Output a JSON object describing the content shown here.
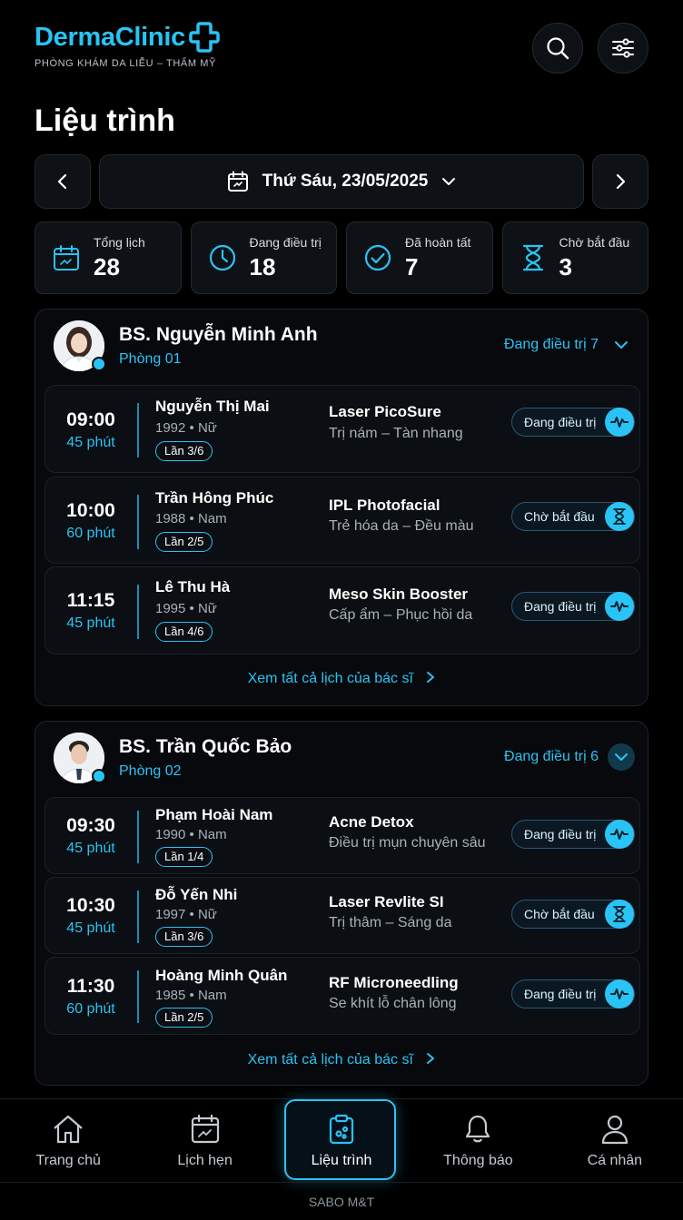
{
  "brand": {
    "name": "DermaClinic",
    "tagline": "PHÒNG KHÁM DA LIỄU – THẨM MỸ"
  },
  "page_title": "Liệu trình",
  "date_label": "Thứ Sáu, 23/05/2025",
  "stats": [
    {
      "label": "Tổng lịch",
      "value": "28",
      "icon": "calendar-icon"
    },
    {
      "label": "Đang điều trị",
      "value": "18",
      "icon": "clock-icon"
    },
    {
      "label": "Đã hoàn tất",
      "value": "7",
      "icon": "check-circle-icon"
    },
    {
      "label": "Chờ bắt đầu",
      "value": "3",
      "icon": "hourglass-icon"
    }
  ],
  "doctors": [
    {
      "name": "BS. Nguyễn Minh Anh",
      "room": "Phòng 01",
      "status": "Đang điều trị 7",
      "view_all": "Xem tất cả lịch của bác sĩ",
      "appointments": [
        {
          "time": "09:00",
          "duration": "45 phút",
          "patient": "Nguyễn Thị Mai",
          "info": "1992 • Nữ",
          "session": "Lần 3/6",
          "service": "Laser PicoSure",
          "desc": "Trị nám – Tàn nhang",
          "status": "Đang điều trị"
        },
        {
          "time": "10:00",
          "duration": "60 phút",
          "patient": "Trần Hông Phúc",
          "info": "1988 • Nam",
          "session": "Lần 2/5",
          "service": "IPL Photofacial",
          "desc": "Trẻ hóa da – Đều màu",
          "status": "Chờ bắt đầu"
        },
        {
          "time": "11:15",
          "duration": "45 phút",
          "patient": "Lê Thu Hà",
          "info": "1995 • Nữ",
          "session": "Lần 4/6",
          "service": "Meso Skin Booster",
          "desc": "Cấp ẩm – Phục hồi da",
          "status": "Đang điều trị"
        }
      ]
    },
    {
      "name": "BS. Trần Quốc Bảo",
      "room": "Phòng 02",
      "status": "Đang điều trị 6",
      "view_all": "Xem tất cả lịch của bác sĩ",
      "appointments": [
        {
          "time": "09:30",
          "duration": "45 phút",
          "patient": "Phạm Hoài Nam",
          "info": "1990 • Nam",
          "session": "Lần 1/4",
          "service": "Acne Detox",
          "desc": "Điều trị mụn chuyên sâu",
          "status": "Đang điều trị"
        },
        {
          "time": "10:30",
          "duration": "45 phút",
          "patient": "Đỗ Yến Nhi",
          "info": "1997 • Nữ",
          "session": "Lần 3/6",
          "service": "Laser Revlite SI",
          "desc": "Trị thâm – Sáng da",
          "status": "Chờ bắt đầu"
        },
        {
          "time": "11:30",
          "duration": "60 phút",
          "patient": "Hoàng Minh Quân",
          "info": "1985 • Nam",
          "session": "Lần 2/5",
          "service": "RF Microneedling",
          "desc": "Se khít lỗ chân lông",
          "status": "Đang điều trị"
        }
      ]
    }
  ],
  "nav": [
    {
      "label": "Trang chủ",
      "icon": "home-icon"
    },
    {
      "label": "Lịch hẹn",
      "icon": "calendar-icon"
    },
    {
      "label": "Liệu trình",
      "icon": "clipboard-icon",
      "active": true
    },
    {
      "label": "Thông báo",
      "icon": "bell-icon"
    },
    {
      "label": "Cá nhân",
      "icon": "user-icon"
    }
  ],
  "footer": "SABO M&T",
  "colors": {
    "accent": "#29c4f5",
    "background": "#000000",
    "card": "#0e1115"
  }
}
